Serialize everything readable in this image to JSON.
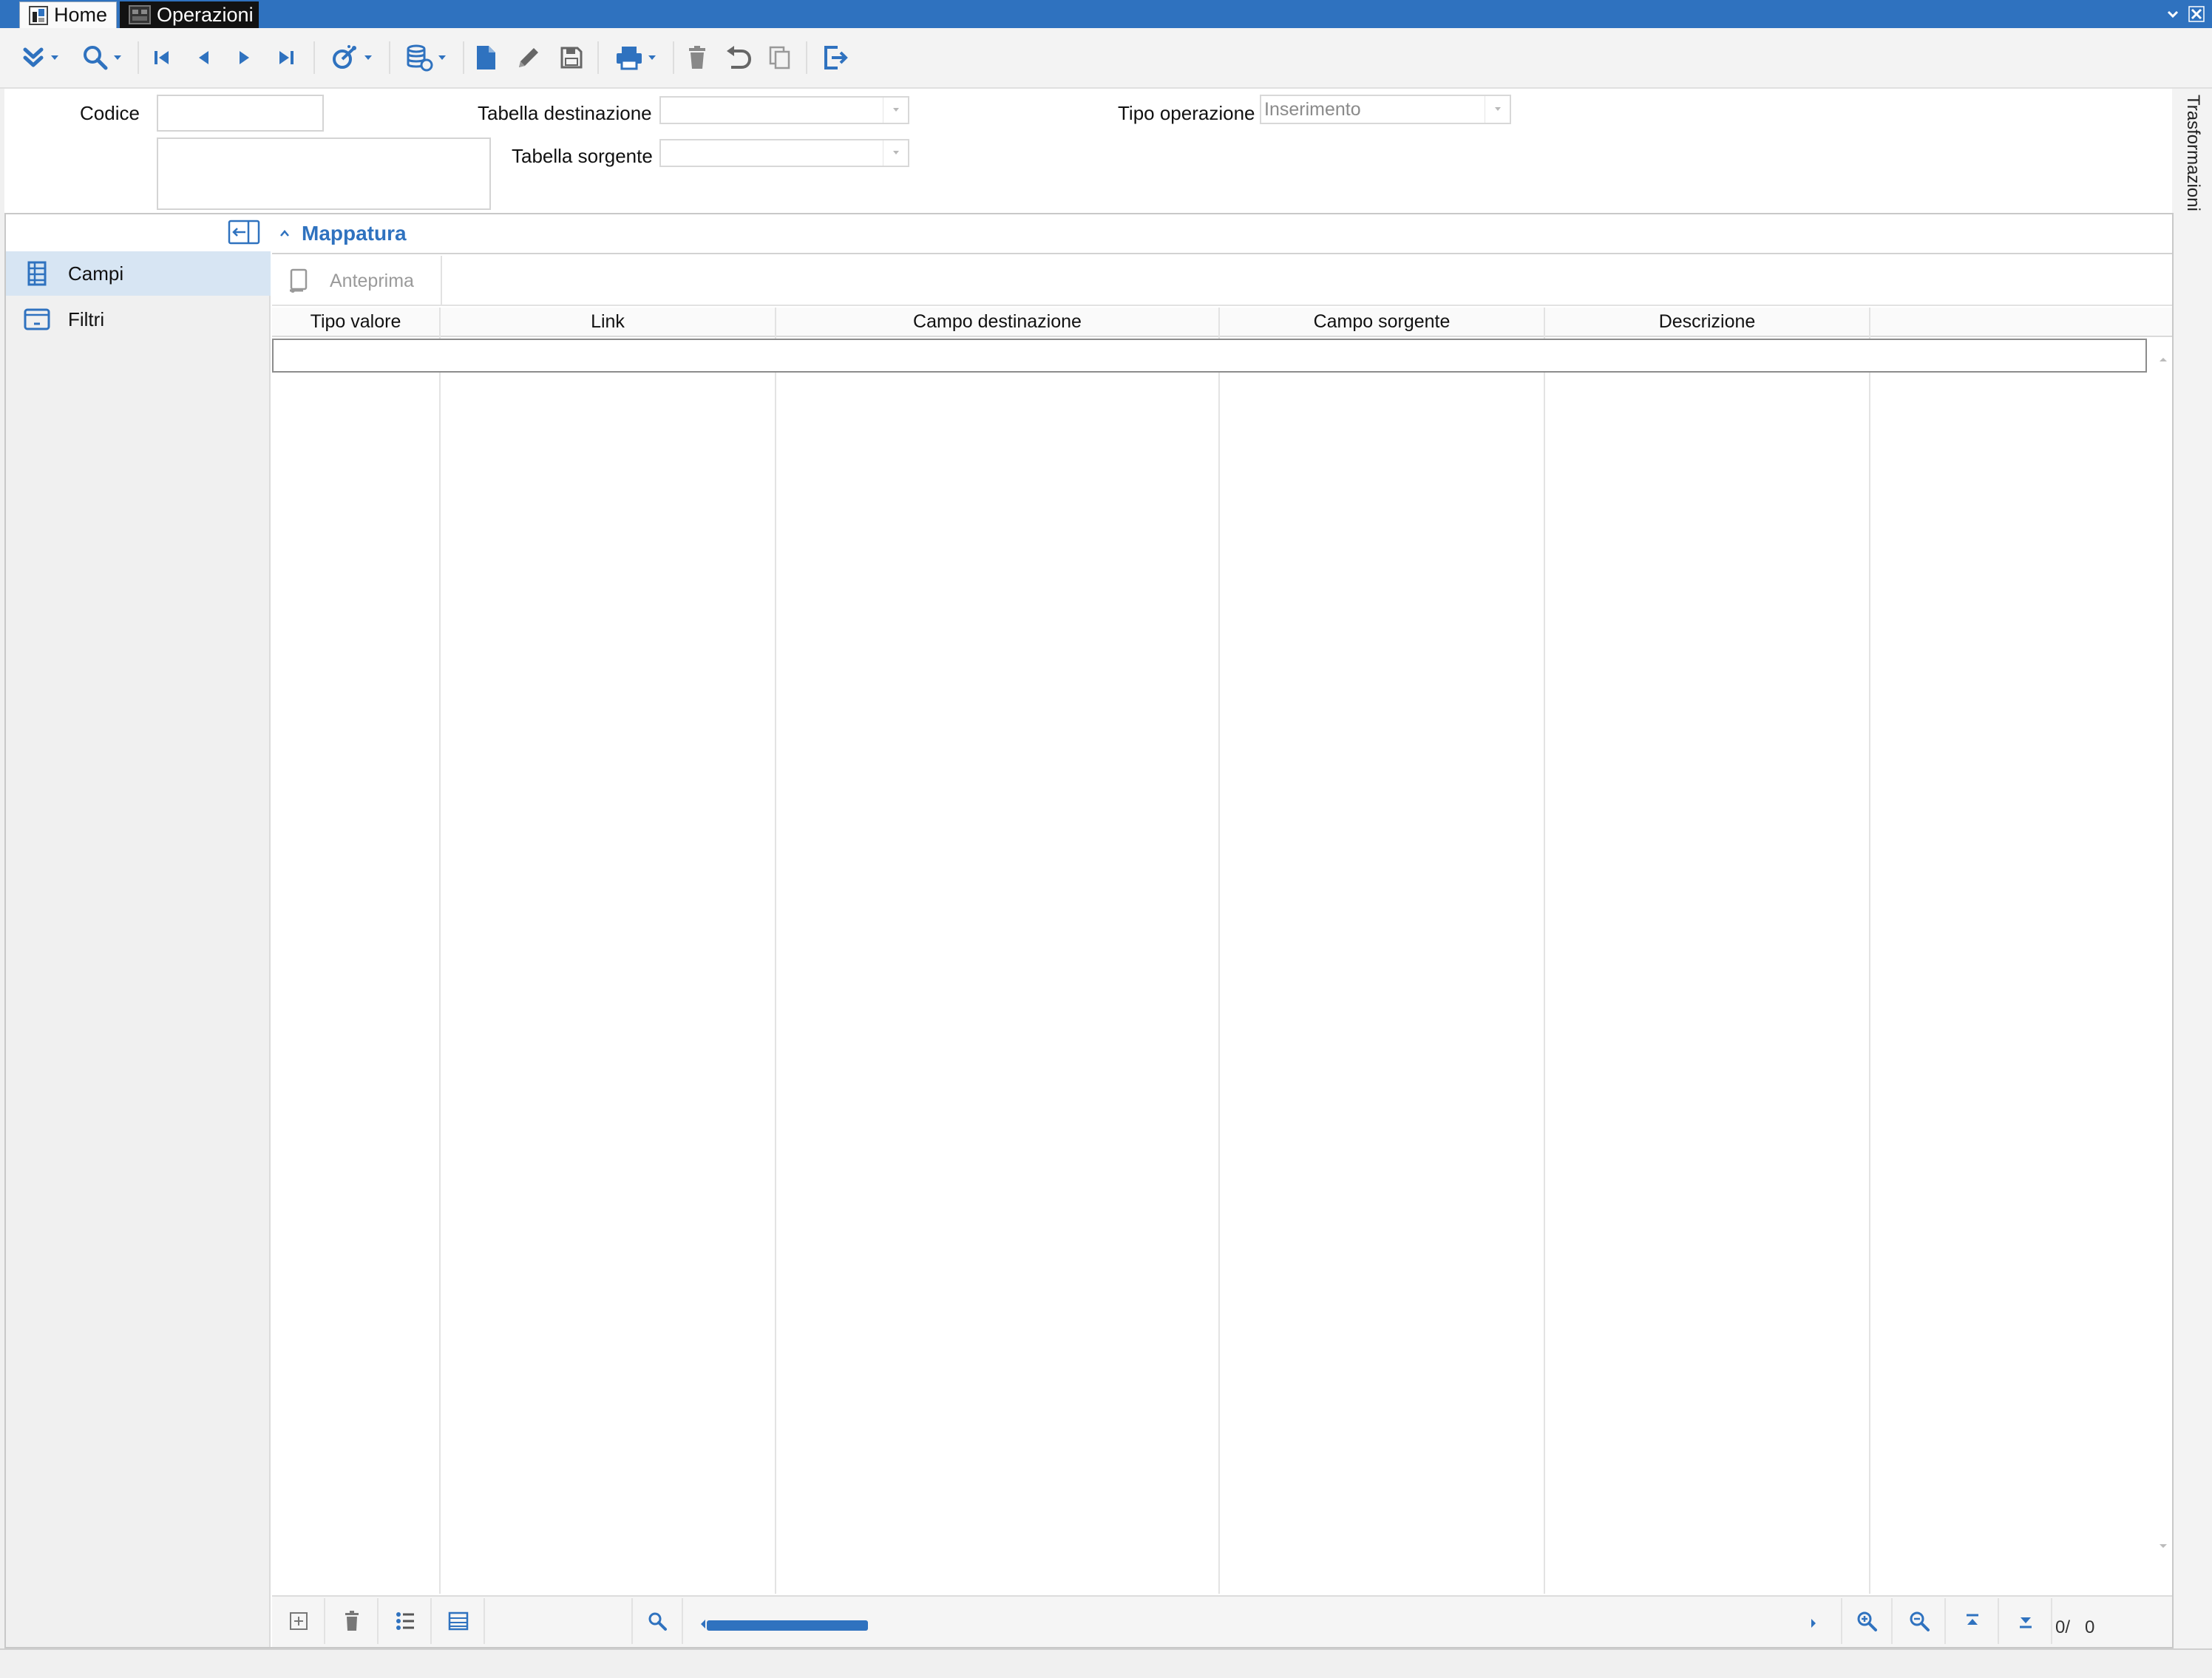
{
  "tabs": [
    {
      "label": "Home",
      "icon": "home-app-icon"
    },
    {
      "label": "Operazioni",
      "icon": "operations-icon"
    }
  ],
  "toolbar": {
    "buttons": [
      "expand-icon",
      "search-icon",
      "first-record-icon",
      "previous-record-icon",
      "next-record-icon",
      "last-record-icon",
      "wizard-icon",
      "database-icon",
      "new-document-icon",
      "edit-icon",
      "save-icon",
      "print-icon",
      "delete-icon",
      "undo-icon",
      "copy-icon",
      "exit-icon"
    ]
  },
  "form": {
    "codice_label": "Codice",
    "codice_value": "",
    "description_value": "",
    "tabella_destinazione_label": "Tabella destinazione",
    "tabella_destinazione_value": "",
    "tabella_sorgente_label": "Tabella sorgente",
    "tabella_sorgente_value": "",
    "tipo_operazione_label": "Tipo operazione",
    "tipo_operazione_value": "Inserimento"
  },
  "side_tab": {
    "label": "Trasformazioni"
  },
  "nav": {
    "items": [
      {
        "label": "Campi",
        "icon": "table-grid-icon",
        "selected": true
      },
      {
        "label": "Filtri",
        "icon": "filter-card-icon",
        "selected": false
      }
    ]
  },
  "section": {
    "title": "Mappatura"
  },
  "subtoolbar": {
    "preview_label": "Anteprima"
  },
  "grid": {
    "columns": [
      "Tipo valore",
      "Link",
      "Campo destinazione",
      "Campo sorgente",
      "Descrizione",
      ""
    ],
    "rows": []
  },
  "footer": {
    "record_count": "0/   0"
  },
  "colors": {
    "accent": "#2f72bf",
    "selected_nav": "#d7e5f3",
    "tab_dark": "#121212"
  }
}
